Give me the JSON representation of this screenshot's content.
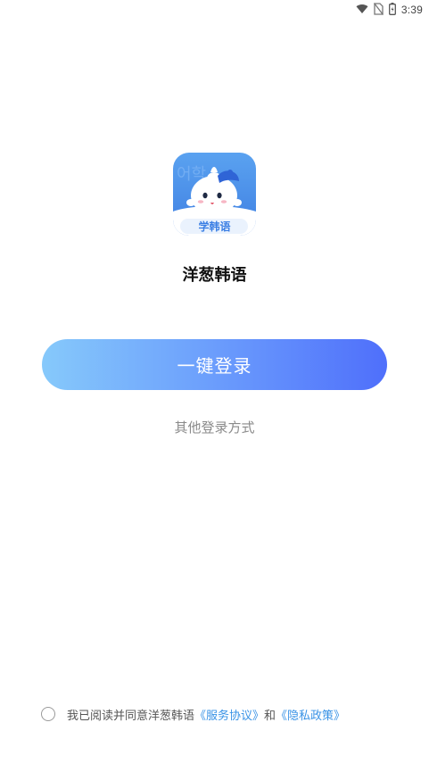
{
  "status_bar": {
    "time": "3:39",
    "icons": [
      "wifi-icon",
      "no-sim-icon",
      "battery-icon"
    ]
  },
  "app": {
    "logo_caption": "学韩语",
    "logo_watermark": "어학",
    "name": "洋葱韩语"
  },
  "actions": {
    "one_click_login": "一键登录",
    "other_login": "其他登录方式"
  },
  "agreement": {
    "prefix": "我已阅读并同意洋葱韩语",
    "service_link": "《服务协议》",
    "conjunction": "和",
    "privacy_link": "《隐私政策》"
  },
  "colors": {
    "button_gradient_start": "#86c9fb",
    "button_gradient_end": "#4f6ffb",
    "link": "#3a93e6",
    "logo_bg": "#4f8fe8"
  }
}
